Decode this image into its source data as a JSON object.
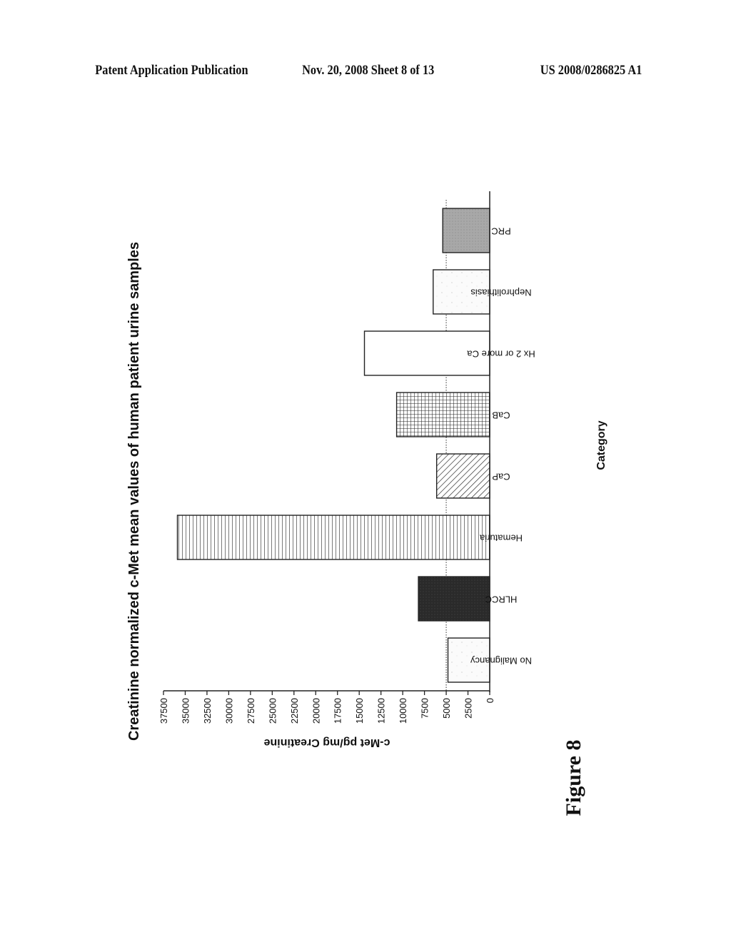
{
  "header": {
    "publication": "Patent Application Publication",
    "date_sheet": "Nov. 20, 2008   Sheet 8 of 13",
    "patent_number": "US 2008/0286825 A1"
  },
  "figure_label": "Figure 8",
  "chart_data": {
    "type": "bar",
    "orientation": "rotated-90",
    "title": "Creatinine normalized c-Met mean values of human patient urine samples",
    "xlabel": "Category",
    "ylabel": "c-Met pg/mg Creatinine",
    "categories": [
      "No Malignancy",
      "HLRCC",
      "Hematuria",
      "CaP",
      "CaB",
      "Hx 2 or more Ca",
      "Nephrolithiasis",
      "PRC"
    ],
    "values": [
      4800,
      8200,
      35900,
      6100,
      10700,
      14400,
      6500,
      5400
    ],
    "patterns": [
      "light-speckle",
      "dark-fill",
      "vertical-lines",
      "diagonal-hatch",
      "grid",
      "empty",
      "light-speckle",
      "gray-fill"
    ],
    "ylim": [
      0,
      37500
    ],
    "yticks": [
      "0",
      "2500",
      "5000",
      "7500",
      "10000",
      "12500",
      "15000",
      "17500",
      "20000",
      "22500",
      "25000",
      "27500",
      "30000",
      "32500",
      "35000",
      "37500"
    ],
    "reference_line": 5000,
    "grid": false,
    "legend": "none"
  }
}
